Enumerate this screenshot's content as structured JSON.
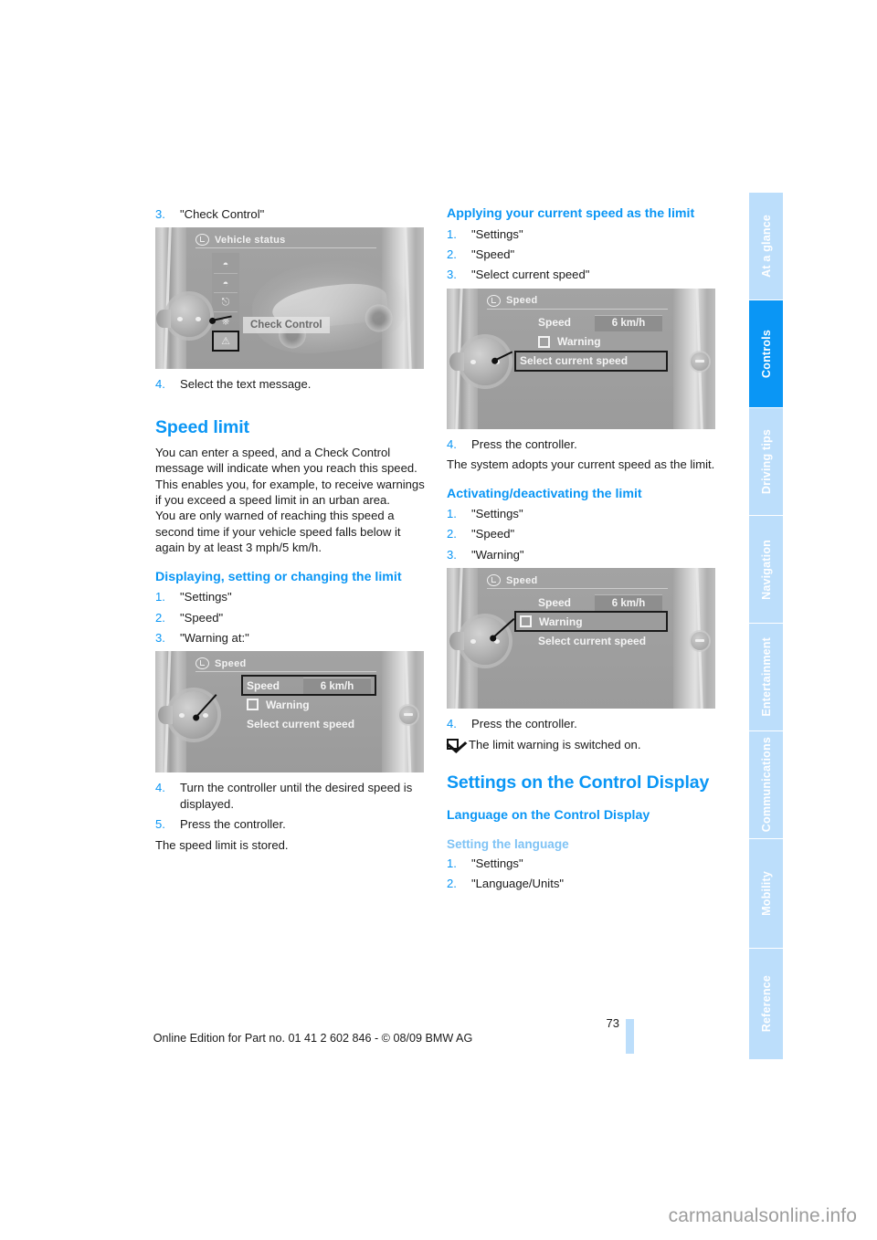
{
  "document": {
    "page_number": "73",
    "footer_line": "Online Edition for Part no. 01 41 2 602 846 - © 08/09 BMW AG",
    "watermark": "carmanualsonline.info"
  },
  "side_tabs": [
    {
      "label": "At a glance",
      "active": false
    },
    {
      "label": "Controls",
      "active": true
    },
    {
      "label": "Driving tips",
      "active": false
    },
    {
      "label": "Navigation",
      "active": false
    },
    {
      "label": "Entertainment",
      "active": false
    },
    {
      "label": "Communications",
      "active": false
    },
    {
      "label": "Mobility",
      "active": false
    },
    {
      "label": "Reference",
      "active": false
    }
  ],
  "colors": {
    "accent_blue": "#0a96f5",
    "light_blue": "#7fc3f5",
    "tab_inactive": "#bcdefb",
    "text": "#1a1a1a"
  },
  "left_column": {
    "step3": {
      "num": "3.",
      "text": "\"Check Control\""
    },
    "vehicle_status_figure": {
      "screen_title": "Vehicle status",
      "tooltip": "Check Control",
      "icons": [
        "tire-pressure-icon",
        "tire-warning-icon",
        "engine-oil-icon",
        "car-icon",
        "warning-triangle-icon"
      ],
      "selected_icon": "warning-triangle-icon"
    },
    "step4": {
      "num": "4.",
      "text": "Select the text message."
    },
    "heading_speed_limit": "Speed limit",
    "intro_paragraph_1": "You can enter a speed, and a Check Control message will indicate when you reach this speed. This enables you, for example, to receive warnings if you exceed a speed limit in an urban area.",
    "intro_paragraph_2": "You are only warned of reaching this speed a second time if your vehicle speed falls below it again by at least 3 mph/5 km/h.",
    "heading_displaying": "Displaying, setting or changing the limit",
    "steps": [
      {
        "num": "1.",
        "text": "\"Settings\""
      },
      {
        "num": "2.",
        "text": "\"Speed\""
      },
      {
        "num": "3.",
        "text": "\"Warning at:\""
      }
    ],
    "speed_figure": {
      "screen_title": "Speed",
      "row_speed_label": "Speed",
      "row_speed_value": "6 km/h",
      "row_warning_label": "Warning",
      "row_select_label": "Select current speed",
      "selected_row": "Speed"
    },
    "steps_after": [
      {
        "num": "4.",
        "text": "Turn the controller until the desired speed is displayed."
      },
      {
        "num": "5.",
        "text": "Press the controller."
      }
    ],
    "closing_text": "The speed limit is stored."
  },
  "right_column": {
    "heading_applying": "Applying your current speed as the limit",
    "applying_steps": [
      {
        "num": "1.",
        "text": "\"Settings\""
      },
      {
        "num": "2.",
        "text": "\"Speed\""
      },
      {
        "num": "3.",
        "text": "\"Select current speed\""
      }
    ],
    "speed_figure_select": {
      "screen_title": "Speed",
      "row_speed_label": "Speed",
      "row_speed_value": "6 km/h",
      "row_warning_label": "Warning",
      "row_select_label": "Select current speed",
      "selected_row": "Select current speed"
    },
    "applying_step4": {
      "num": "4.",
      "text": "Press the controller."
    },
    "applying_result": "The system adopts your current speed as the limit.",
    "heading_activating": "Activating/deactivating the limit",
    "activating_steps": [
      {
        "num": "1.",
        "text": "\"Settings\""
      },
      {
        "num": "2.",
        "text": "\"Speed\""
      },
      {
        "num": "3.",
        "text": "\"Warning\""
      }
    ],
    "speed_figure_warning": {
      "screen_title": "Speed",
      "row_speed_label": "Speed",
      "row_speed_value": "6 km/h",
      "row_warning_label": "Warning",
      "row_select_label": "Select current speed",
      "selected_row": "Warning"
    },
    "activating_step4": {
      "num": "4.",
      "text": "Press the controller."
    },
    "activating_result": "The limit warning is switched on.",
    "heading_settings_control_display": "Settings on the Control Display",
    "heading_language": "Language on the Control Display",
    "heading_setting_language": "Setting the language",
    "language_steps": [
      {
        "num": "1.",
        "text": "\"Settings\""
      },
      {
        "num": "2.",
        "text": "\"Language/Units\""
      }
    ]
  }
}
